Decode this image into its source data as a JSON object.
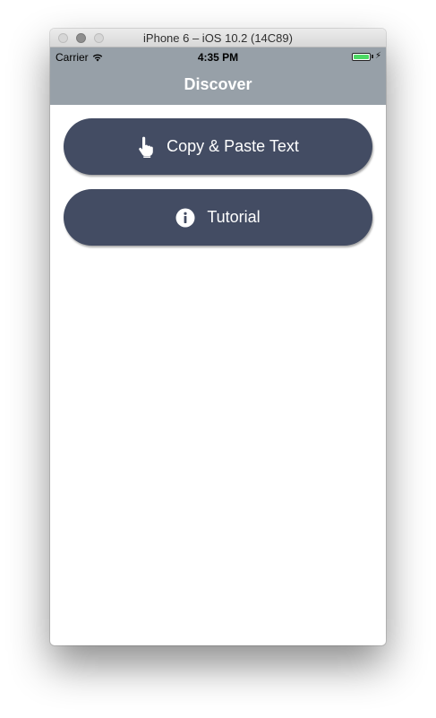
{
  "window": {
    "title": "iPhone 6 – iOS 10.2 (14C89)"
  },
  "status_bar": {
    "carrier": "Carrier",
    "time": "4:35 PM",
    "battery_level": 1.0,
    "battery_color": "#4cd964"
  },
  "nav_bar": {
    "title": "Discover",
    "background": "#97a0a8"
  },
  "buttons": [
    {
      "label": "Copy & Paste Text",
      "icon": "hand-pointer-icon"
    },
    {
      "label": "Tutorial",
      "icon": "info-circle-icon"
    }
  ],
  "colors": {
    "button_bg": "#434c63",
    "button_text": "#ffffff"
  }
}
